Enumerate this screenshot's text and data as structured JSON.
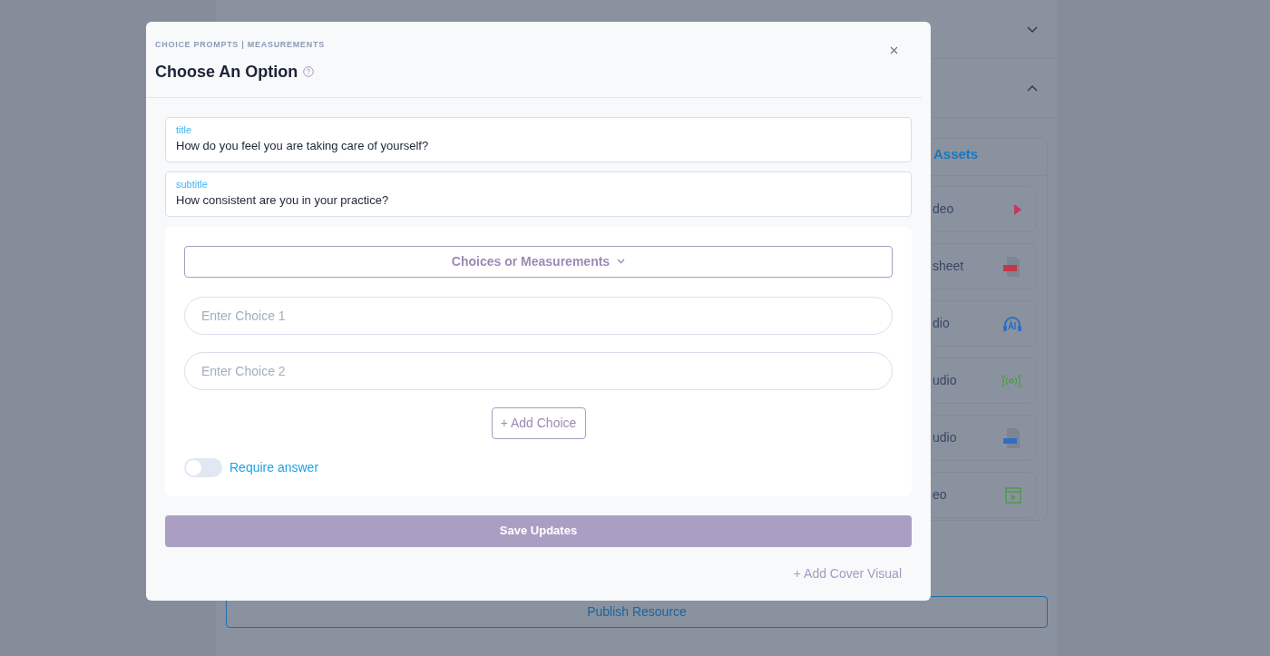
{
  "background": {
    "accordion": [
      {
        "expanded": false
      },
      {
        "expanded": true
      }
    ],
    "assets": {
      "heading": "Assets",
      "items": [
        {
          "label": "deo",
          "kind": "video"
        },
        {
          "label": "sheet",
          "kind": "pdf"
        },
        {
          "label": "dio",
          "kind": "ai_audio"
        },
        {
          "label": "udio",
          "kind": "broadcast"
        },
        {
          "label": "udio",
          "kind": "audio_file"
        },
        {
          "label": "eo",
          "kind": "clip"
        }
      ]
    },
    "publish_button": "Publish Resource"
  },
  "modal": {
    "breadcrumb": "CHOICE PROMPTS | MEASUREMENTS",
    "title": "Choose An Option",
    "fields": [
      {
        "label": "title",
        "value": "How do you feel you are taking care of yourself?"
      },
      {
        "label": "subtitle",
        "value": "How consistent are you in your practice?"
      }
    ],
    "dropdown": "Choices or Measurements",
    "choices": [
      {
        "placeholder": "Enter Choice 1"
      },
      {
        "placeholder": "Enter Choice 2"
      }
    ],
    "add_choice": "+ Add Choice",
    "require_answer": {
      "label": "Require answer",
      "on": false
    },
    "save_button": "Save Updates",
    "add_cover": "+ Add Cover Visual"
  }
}
